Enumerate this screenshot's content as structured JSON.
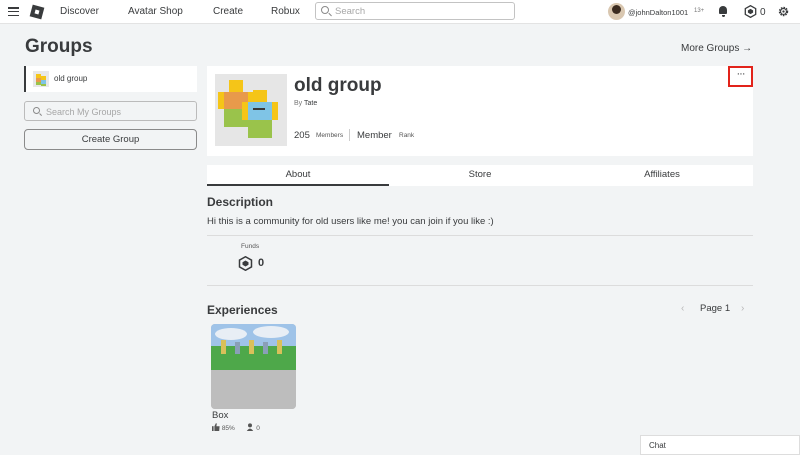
{
  "topbar": {
    "nav": [
      "Discover",
      "Avatar Shop",
      "Create",
      "Robux"
    ],
    "search_placeholder": "Search",
    "username": "@johnDalton1001",
    "age_badge": "13+",
    "robux_balance": "0",
    "icons": [
      "menu-icon",
      "roblox-logo",
      "search-icon",
      "notifications-bell-icon",
      "robux-icon",
      "settings-gear-icon"
    ]
  },
  "sidebar": {
    "title": "Groups",
    "groups": [
      {
        "label": "old group"
      }
    ],
    "search_placeholder": "Search My Groups",
    "create_label": "Create Group"
  },
  "header": {
    "more_groups": "More Groups →"
  },
  "group": {
    "name": "old group",
    "by_prefix": "By",
    "owner": "Tate",
    "members_count": "205",
    "members_label": "Members",
    "rank_value": "Member",
    "rank_label": "Rank",
    "more_label": "···"
  },
  "tabs": [
    {
      "label": "About",
      "active": true
    },
    {
      "label": "Store",
      "active": false
    },
    {
      "label": "Affiliates",
      "active": false
    }
  ],
  "about": {
    "description_title": "Description",
    "description": "Hi this is a community for old users like me! you can join if you like :)",
    "funds_label": "Funds",
    "funds_value": "0"
  },
  "experiences": {
    "title": "Experiences",
    "page_label": "Page 1",
    "items": [
      {
        "name": "Box",
        "like_ratio": "85%",
        "players": "0"
      }
    ]
  },
  "chat": {
    "label": "Chat"
  },
  "colors": {
    "accent_highlight": "#e2231a",
    "background": "#f2f4f5",
    "text": "#393b3d"
  }
}
